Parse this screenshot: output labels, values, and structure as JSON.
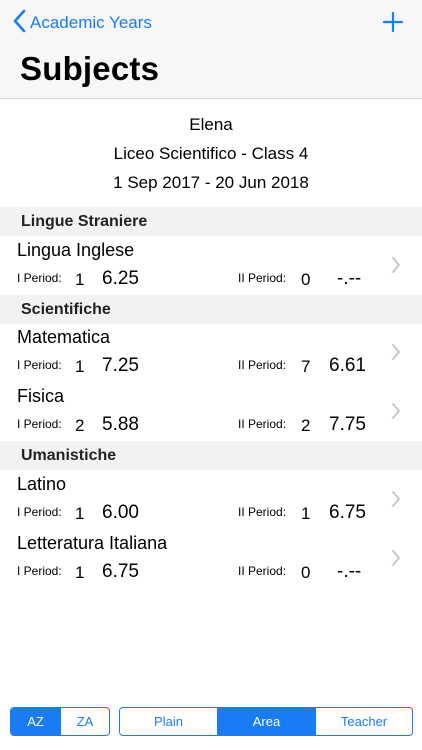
{
  "nav": {
    "back_label": "Academic Years",
    "title": "Subjects"
  },
  "info": {
    "student": "Elena",
    "school": "Liceo Scientifico - Class 4",
    "period": "1 Sep 2017 - 20 Jun 2018"
  },
  "labels": {
    "p1": "I Period:",
    "p2": "II Period:"
  },
  "sections": [
    {
      "title": "Lingue Straniere",
      "subjects": [
        {
          "name": "Lingua Inglese",
          "p1_count": "1",
          "p1_grade": "6.25",
          "p2_count": "0",
          "p2_grade": "-.--"
        }
      ]
    },
    {
      "title": "Scientifiche",
      "subjects": [
        {
          "name": "Matematica",
          "p1_count": "1",
          "p1_grade": "7.25",
          "p2_count": "7",
          "p2_grade": "6.61"
        },
        {
          "name": "Fisica",
          "p1_count": "2",
          "p1_grade": "5.88",
          "p2_count": "2",
          "p2_grade": "7.75"
        }
      ]
    },
    {
      "title": "Umanistiche",
      "subjects": [
        {
          "name": "Latino",
          "p1_count": "1",
          "p1_grade": "6.00",
          "p2_count": "1",
          "p2_grade": "6.75"
        },
        {
          "name": "Letteratura Italiana",
          "p1_count": "1",
          "p1_grade": "6.75",
          "p2_count": "0",
          "p2_grade": "-.--"
        }
      ]
    }
  ],
  "toolbar": {
    "sort": [
      "AZ",
      "ZA"
    ],
    "sort_selected": "AZ",
    "view": [
      "Plain",
      "Area",
      "Teacher"
    ],
    "view_selected": "Area"
  },
  "colors": {
    "accent": "#1a7cf4",
    "section_bg": "#f2f2f2",
    "chevron": "#c7c7cc"
  }
}
